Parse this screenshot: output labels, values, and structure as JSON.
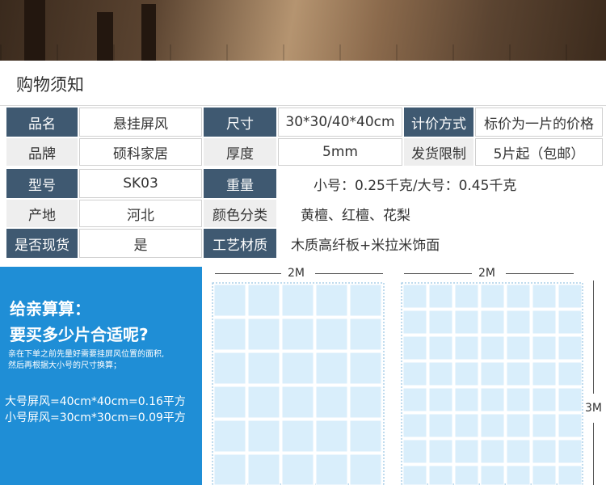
{
  "info": {
    "title": "购物须知",
    "rows": [
      {
        "label1": "品名",
        "value1": "悬挂屏风",
        "label2": "尺寸",
        "value2": "30*30/40*40cm",
        "label3": "计价方式",
        "value3": "标价为一片的价格"
      },
      {
        "label1": "品牌",
        "value1": "硕科家居",
        "label2": "厚度",
        "value2": "5mm",
        "label3": "发货限制",
        "value3": "5片起（包邮）"
      },
      {
        "label1": "型号",
        "value1": "SK03",
        "label2": "重量",
        "value2": "小号：0.25千克/大号：0.45千克"
      },
      {
        "label1": "产地",
        "value1": "河北",
        "label2": "颜色分类",
        "value2": "黄檀、红檀、花梨"
      },
      {
        "label1": "是否现货",
        "value1": "是",
        "label2": "工艺材质",
        "value2": "木质高纤板+米拉米饰面"
      }
    ]
  },
  "calc": {
    "heading_line1": "给亲算算：",
    "heading_line2": "要买多少片合适呢?",
    "note_line1": "亲在下单之前先量好需要挂屏风位置的面积,",
    "note_line2": "然后再根据大小号的尺寸换算；",
    "formula_large": "大号屏风=40cm*40cm=0.16平方",
    "formula_small": "小号屏风=30cm*30cm=0.09平方"
  },
  "diagram": {
    "left_width_label": "2M",
    "right_width_label": "2M",
    "height_label": "3M"
  },
  "colors": {
    "label_dark": "#3f5971",
    "label_light": "#eeeeee",
    "blue_panel": "#1f8ed6",
    "grid_fill": "#d9eefb"
  }
}
